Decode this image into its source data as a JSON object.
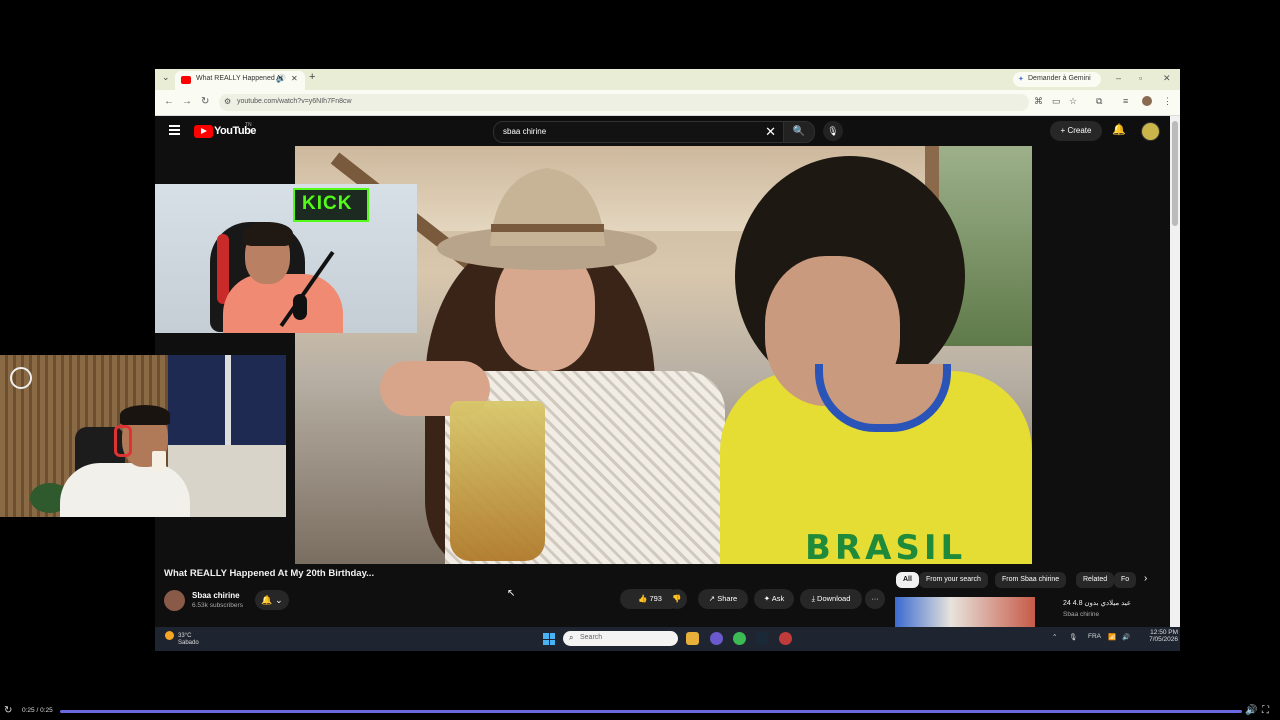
{
  "browser": {
    "tab_title": "What REALLY Happened At",
    "new_tab": "+",
    "gemini": "Demander à Gemini",
    "url": "youtube.com/watch?v=y6NIh7Fn8cw"
  },
  "youtube": {
    "logo": "YouTube",
    "logo_suffix": "TN",
    "search_query": "sbaa chirine",
    "create": "Create"
  },
  "video": {
    "title": "What REALLY Happened At My 20th Birthday...",
    "shirt_text": "BRASIL"
  },
  "channel": {
    "name": "Sbaa chirine",
    "subscribers": "6.53k subscribers"
  },
  "actions": {
    "likes": "793",
    "share": "Share",
    "ask": "Ask",
    "download": "Download",
    "more": "···"
  },
  "chips": [
    "All",
    "From your search",
    "From Sbaa chirine",
    "Related",
    "Fo"
  ],
  "recommended": {
    "title": "24 عيد ميلادي بدون 4.8",
    "channel": "Sbaa chirine"
  },
  "taskbar": {
    "temp": "33°C",
    "weather": "Sabado",
    "search": "Search",
    "lang": "FRA",
    "time": "12:50 PM",
    "date": "7/05/2026"
  },
  "overlay": {
    "kick_logo": "KICK"
  },
  "player": {
    "time": "0:25 / 0:25",
    "progress": 1.0
  },
  "colors": {
    "youtube_red": "#ff0000",
    "kick_green": "#53fc18",
    "progress": "#6a6ae0"
  },
  "icons": [
    "chevron-down-icon",
    "speaker-icon",
    "close-icon",
    "back-icon",
    "forward-icon",
    "reload-icon",
    "menu-icon",
    "search-icon",
    "mic-icon",
    "bell-icon",
    "like-icon",
    "dislike-icon",
    "share-icon",
    "ask-icon",
    "download-icon",
    "windows-icon",
    "replay-icon",
    "volume-icon",
    "fullscreen-icon"
  ]
}
